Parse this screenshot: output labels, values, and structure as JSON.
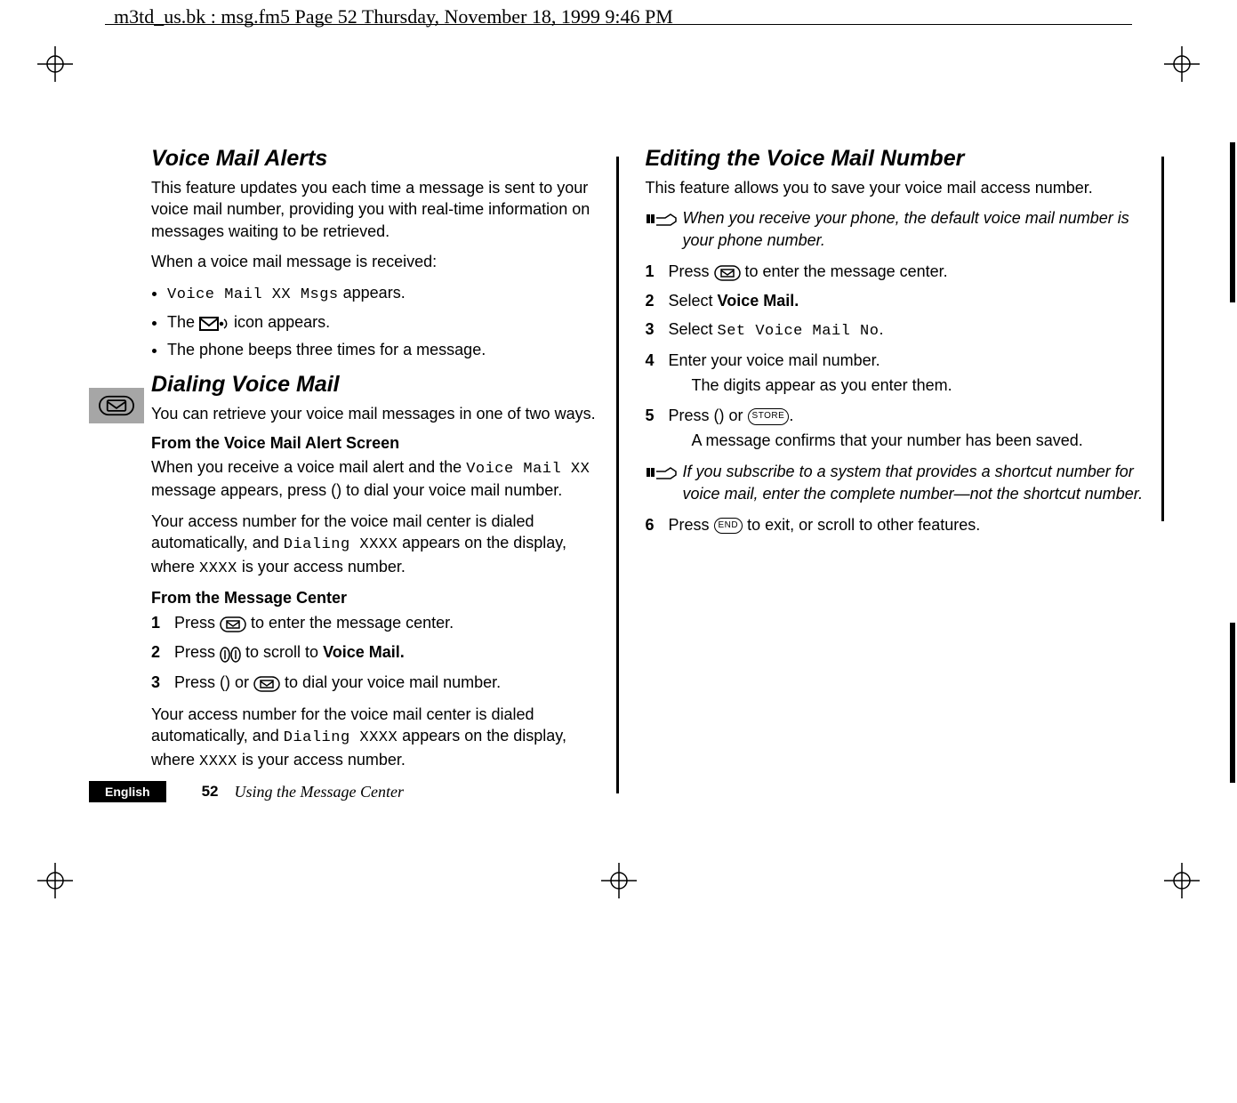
{
  "header": {
    "running_head": "m3td_us.bk : msg.fm5  Page 52  Thursday, November 18, 1999  9:46 PM"
  },
  "footer": {
    "language": "English",
    "page_number": "52",
    "chapter": "Using the Message Center"
  },
  "left": {
    "section1_title": "Voice Mail Alerts",
    "section1_p1": "This feature updates you each time a message is sent to your voice mail number, providing you with real-time information on messages waiting to be retrieved.",
    "section1_p2": "When a voice mail message is received:",
    "bullets": {
      "b1_pre": "",
      "b1_lcd": "Voice Mail XX Msgs",
      "b1_post": " appears.",
      "b2_pre": "The ",
      "b2_icon_name": "envelope-sound-icon",
      "b2_post": " icon appears.",
      "b3": "The phone beeps three times for a message."
    },
    "section2_title": "Dialing Voice Mail",
    "section2_p1": "You can retrieve your voice mail messages in one of two ways.",
    "sub1_title": "From the Voice Mail Alert Screen",
    "sub1_p1_a": "When you receive a voice mail alert and the ",
    "sub1_p1_lcd": "Voice Mail XX",
    "sub1_p1_b": " message appears, press ",
    "sub1_p1_key": "()",
    "sub1_p1_c": " to dial your voice mail number.",
    "sub1_p2_a": "Your access number for the voice mail center is dialed automatically, and ",
    "sub1_p2_lcd": "Dialing XXXX",
    "sub1_p2_b": " appears on the display, where ",
    "sub1_p2_lcd2": "XXXX",
    "sub1_p2_c": " is your access number.",
    "sub2_title": "From the Message Center",
    "steps": {
      "s1_a": "Press ",
      "s1_icon": "envelope-key-icon",
      "s1_b": " to enter the message center.",
      "s2_a": "Press ",
      "s2_icon": "scroll-keys-icon",
      "s2_b": " to scroll to ",
      "s2_bold": "Voice Mail.",
      "s3_a": "Press ",
      "s3_key": "()",
      "s3_b": " or ",
      "s3_icon": "envelope-key-icon",
      "s3_c": " to dial your voice mail number."
    },
    "sub2_p2_a": "Your access number for the voice mail center is dialed automatically, and ",
    "sub2_p2_lcd": "Dialing XXXX",
    "sub2_p2_b": " appears on the display, where ",
    "sub2_p2_lcd2": "XXXX",
    "sub2_p2_c": " is your access number."
  },
  "right": {
    "section_title": "Editing the Voice Mail Number",
    "p1": "This feature allows you to save your voice mail access number.",
    "note1": "When you receive your phone, the default voice mail number is your phone number.",
    "steps": {
      "s1_a": "Press ",
      "s1_icon": "envelope-key-icon",
      "s1_b": " to enter the message center.",
      "s2_a": "Select ",
      "s2_bold": "Voice Mail.",
      "s3_a": "Select ",
      "s3_lcd": "Set Voice Mail No",
      "s3_b": ".",
      "s4": "Enter your voice mail number.",
      "s4_sub": "The digits appear as you enter them.",
      "s5_a": "Press ",
      "s5_key": "()",
      "s5_b": " or ",
      "s5_pill": "STORE",
      "s5_c": ".",
      "s5_sub": "A message confirms that your number has been saved."
    },
    "note2": "If you subscribe to a system that provides a shortcut number for voice mail, enter the complete number—not the shortcut number.",
    "step6_a": "Press ",
    "step6_pill": "END",
    "step6_b": " to exit, or scroll to other features."
  },
  "icons": {
    "envelope_key": "envelope-key-icon",
    "envelope_sound": "envelope-sound-icon",
    "scroll_keys": "scroll-keys-icon",
    "note_hand": "note-hand-icon",
    "register_mark": "register-mark-icon"
  }
}
